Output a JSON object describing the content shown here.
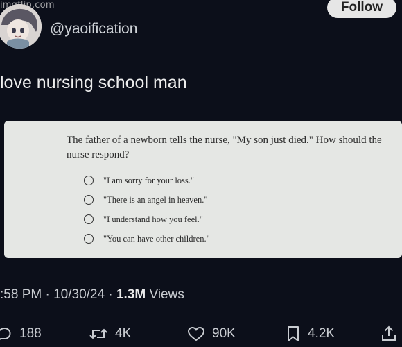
{
  "watermark": "imgflip.com",
  "tweet": {
    "handle": "@yaoification",
    "follow_label": "Follow",
    "text": "love nursing school man"
  },
  "question": {
    "stem": "The father of a newborn tells the nurse, \"My son just died.\" How should the nurse respond?",
    "options": [
      "\"I am sorry for your loss.\"",
      "\"There is an angel in heaven.\"",
      "\"I understand how you feel.\"",
      "\"You can have other children.\""
    ]
  },
  "meta": {
    "time": ":58 PM",
    "date": "10/30/24",
    "views_count": "1.3M",
    "views_label": "Views"
  },
  "actions": {
    "replies": "188",
    "reposts": "4K",
    "likes": "90K",
    "bookmarks": "4.2K"
  },
  "icons": [
    "reply-icon",
    "repost-icon",
    "like-icon",
    "bookmark-icon",
    "share-icon"
  ],
  "colors": {
    "background": "#0c0f1a",
    "follow_button": "#e6e6e6",
    "card": "#e5e7e4"
  }
}
